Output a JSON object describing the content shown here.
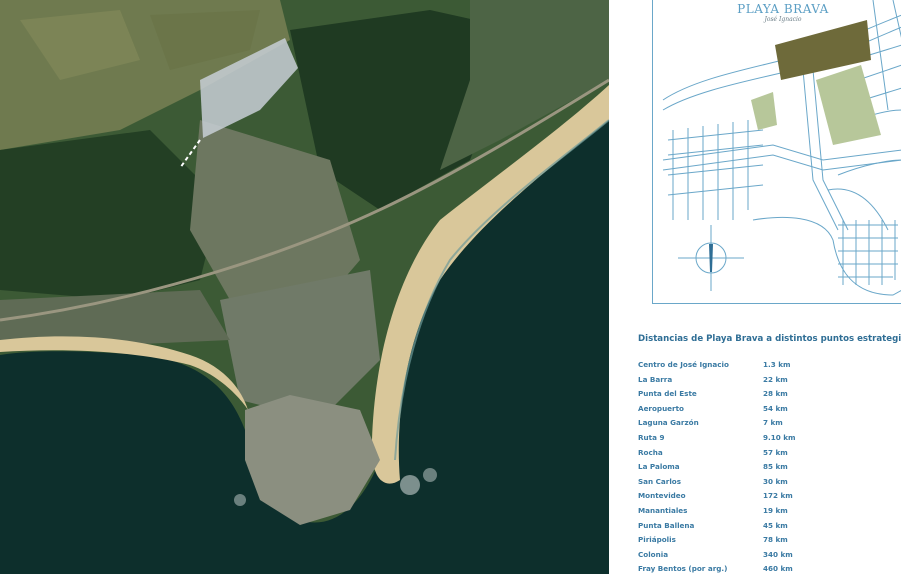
{
  "satellite": {
    "image": "aerial-coastline-photo"
  },
  "plan": {
    "logo_name": "PLAYA BRAVA",
    "logo_subtitle": "José Ignacio",
    "colors": {
      "lines": "#6aa7c9",
      "lot_dark": "#6e6a3a",
      "lot_light": "#b7c79a"
    },
    "compass_icon": "north-arrow-compass-icon"
  },
  "distances": {
    "title": "Distancias de Playa Brava a distintos puntos estrategicos",
    "rows": [
      {
        "place": "Centro de José Ignacio",
        "value": "1.3 km"
      },
      {
        "place": "La Barra",
        "value": "22 km"
      },
      {
        "place": "Punta del Este",
        "value": "28 km"
      },
      {
        "place": "Aeropuerto",
        "value": "54 km"
      },
      {
        "place": "Laguna Garzón",
        "value": "7 km"
      },
      {
        "place": "Ruta 9",
        "value": "9.10 km"
      },
      {
        "place": "Rocha",
        "value": "57 km"
      },
      {
        "place": "La Paloma",
        "value": "85 km"
      },
      {
        "place": "San Carlos",
        "value": "30 km"
      },
      {
        "place": "Montevideo",
        "value": "172 km"
      },
      {
        "place": "Manantiales",
        "value": "19 km"
      },
      {
        "place": "Punta Ballena",
        "value": "45 km"
      },
      {
        "place": "Piriápolis",
        "value": "78 km"
      },
      {
        "place": "Colonia",
        "value": "340 km"
      },
      {
        "place": "Fray Bentos (por arg.)",
        "value": "460 km"
      }
    ]
  }
}
